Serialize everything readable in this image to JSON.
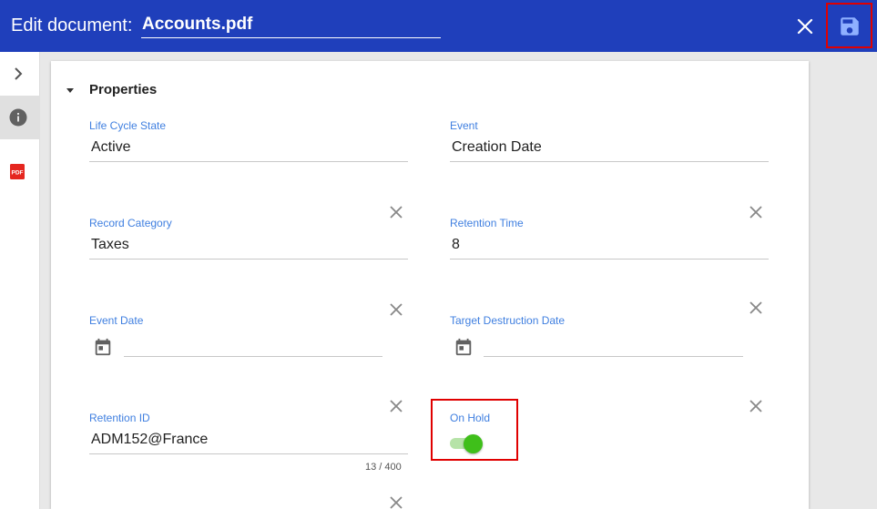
{
  "header": {
    "title": "Edit document:",
    "document_name": "Accounts.pdf",
    "close_icon": "close-icon",
    "save_icon": "save-icon"
  },
  "sidebar": {
    "items": [
      {
        "icon": "chevron-right-icon"
      },
      {
        "icon": "info-icon"
      },
      {
        "icon": "pdf-icon",
        "label": "PDF"
      }
    ]
  },
  "properties": {
    "title": "Properties",
    "fields": {
      "life_cycle_state": {
        "label": "Life Cycle State",
        "value": "Active"
      },
      "event": {
        "label": "Event",
        "value": "Creation Date"
      },
      "record_category": {
        "label": "Record Category",
        "value": "Taxes"
      },
      "retention_time": {
        "label": "Retention Time",
        "value": "8"
      },
      "event_date": {
        "label": "Event Date",
        "value": ""
      },
      "target_destruction_date": {
        "label": "Target Destruction Date",
        "value": ""
      },
      "retention_id": {
        "label": "Retention ID",
        "value": "ADM152@France",
        "counter": "13 / 400"
      },
      "on_hold": {
        "label": "On Hold",
        "checked": true
      }
    }
  },
  "colors": {
    "header": "#1f3fbb",
    "accent_label": "#3f7fe0",
    "toggle_on": "#3fbf1a",
    "highlight": "#e00000"
  }
}
